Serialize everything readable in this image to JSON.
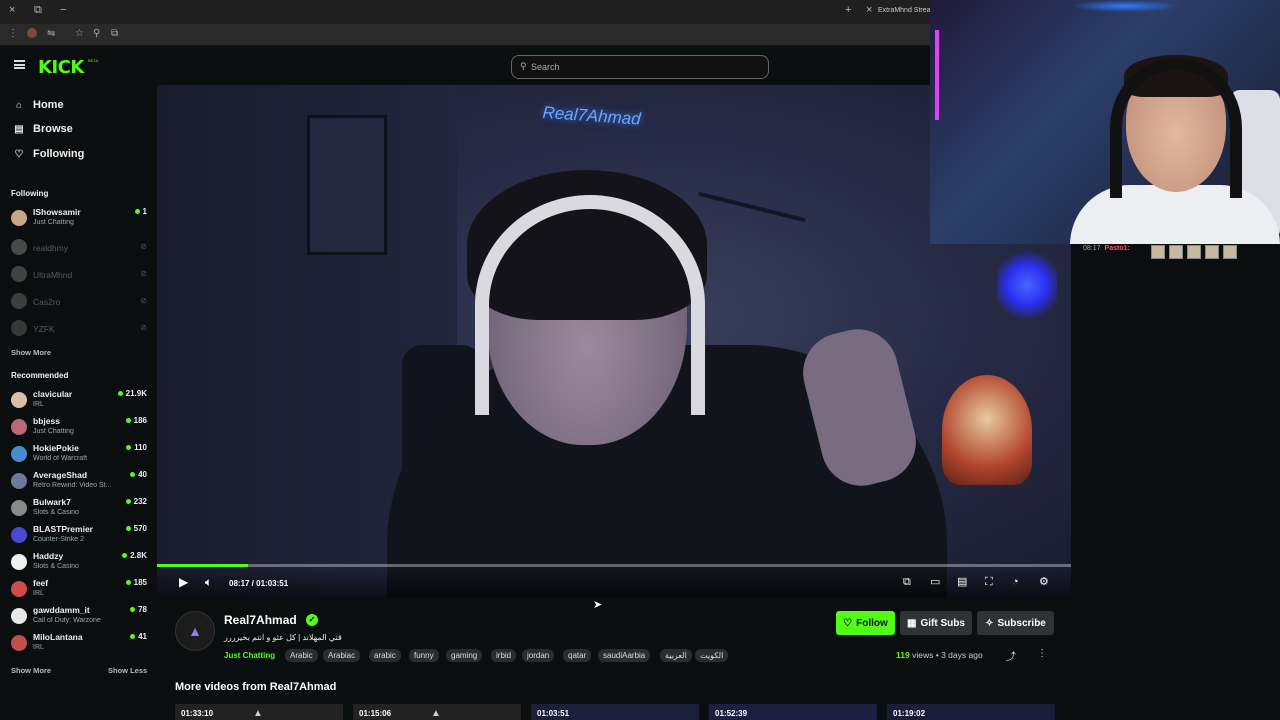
{
  "browser": {
    "tab_title": "ExtraMhnd Strean",
    "tab_controls": [
      "×",
      "⧉",
      "−"
    ],
    "new_tab": "+",
    "close_tab": "×"
  },
  "header": {
    "logo": "KICK",
    "logo_badge": "BETA",
    "search_placeholder": "Search"
  },
  "sidebar": {
    "nav": [
      {
        "label": "Home",
        "icon": "home-icon"
      },
      {
        "label": "Browse",
        "icon": "browse-icon"
      },
      {
        "label": "Following",
        "icon": "heart-icon"
      }
    ],
    "following_heading": "Following",
    "following": [
      {
        "name": "IShowsamir",
        "category": "Just Chatting",
        "viewers": "1",
        "live": true
      },
      {
        "name": "realdhmy",
        "live": false
      },
      {
        "name": "UltraMhnd",
        "live": false
      },
      {
        "name": "Cas2ro",
        "live": false
      },
      {
        "name": "YZFK",
        "live": false
      }
    ],
    "show_more_following": "Show More",
    "recommended_heading": "Recommended",
    "recommended": [
      {
        "name": "clavicular",
        "category": "IRL",
        "viewers": "21.9K"
      },
      {
        "name": "bbjess",
        "category": "Just Chatting",
        "viewers": "186"
      },
      {
        "name": "HokiePokie",
        "category": "World of Warcraft",
        "viewers": "110"
      },
      {
        "name": "AverageShad",
        "category": "Retro Rewind: Video St...",
        "viewers": "40"
      },
      {
        "name": "Bulwark7",
        "category": "Slots & Casino",
        "viewers": "232"
      },
      {
        "name": "BLASTPremier",
        "category": "Counter-Strike 2",
        "viewers": "570"
      },
      {
        "name": "Haddzy",
        "category": "Slots & Casino",
        "viewers": "2.8K"
      },
      {
        "name": "feef",
        "category": "IRL",
        "viewers": "185"
      },
      {
        "name": "gawddamm_it",
        "category": "Call of Duty: Warzone",
        "viewers": "78"
      },
      {
        "name": "MiloLantana",
        "category": "IRL",
        "viewers": "41"
      }
    ],
    "show_more_recommended": "Show More",
    "show_less_recommended": "Show Less"
  },
  "player": {
    "neon_sign": "Real7Ahmad",
    "time": "08:17 / 01:03:51",
    "progress_fraction": 0.1,
    "accent": "#53fc18"
  },
  "chat": {
    "time": "08:17",
    "user": "Pasto1:"
  },
  "video_info": {
    "channel": "Real7Ahmad",
    "title": "قتي المهلاند | كل عثو و انتم بخيرررر",
    "category": "Just Chatting",
    "tags": [
      "Arabic",
      "Arabiac",
      "arabic",
      "funny",
      "gaming",
      "irbid",
      "jordan",
      "qatar",
      "saudiAarbia",
      "العربية",
      "الكويت"
    ],
    "follow_label": "Follow",
    "gift_label": "Gift Subs",
    "subscribe_label": "Subscribe",
    "views_count": "119",
    "views_word": "views",
    "age": "3 days ago"
  },
  "more_videos": {
    "heading": "More videos from Real7Ahmad",
    "durations": [
      "01:33:10",
      "01:15:06",
      "01:03:51",
      "01:52:39",
      "01:19:02"
    ]
  }
}
